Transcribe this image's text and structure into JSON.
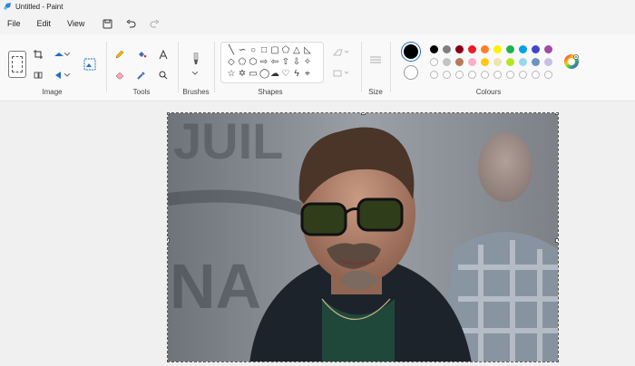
{
  "window": {
    "title": "Untitled - Paint"
  },
  "menu": {
    "file": "File",
    "edit": "Edit",
    "view": "View"
  },
  "groups": {
    "image": "Image",
    "tools": "Tools",
    "brushes": "Brushes",
    "shapes": "Shapes",
    "size": "Size",
    "colours": "Colours"
  },
  "colors": {
    "primary": "#000000",
    "secondary": "#ffffff",
    "palette_row1": [
      "#000000",
      "#7f7f7f",
      "#880015",
      "#ed1c24",
      "#ff7f27",
      "#fff200",
      "#22b14c",
      "#00a2e8",
      "#3f48cc",
      "#a349a4"
    ],
    "palette_row2": [
      "#ffffff",
      "#c3c3c3",
      "#b97a57",
      "#ffaec9",
      "#ffc90e",
      "#efe4b0",
      "#b5e61d",
      "#99d9ea",
      "#7092be",
      "#c8bfe7"
    ]
  },
  "canvas": {
    "image": "portrait-photo"
  }
}
